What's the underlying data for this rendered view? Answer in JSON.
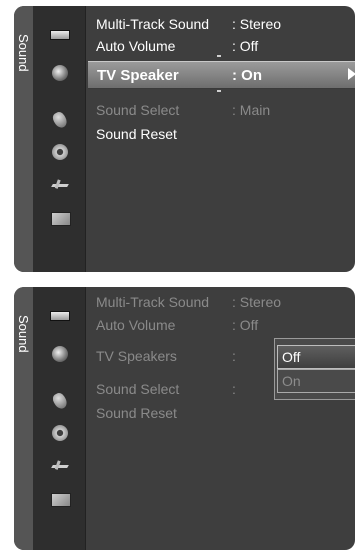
{
  "panel1": {
    "side_label": "Sound",
    "menu": [
      {
        "label": "Multi-Track Sound",
        "value": ": Stereo"
      },
      {
        "label": "Auto Volume",
        "value": ": Off"
      },
      {
        "label": "TV Speaker",
        "value": ": On"
      },
      {
        "label": "Sound Select",
        "value": ": Main"
      },
      {
        "label": "Sound Reset",
        "value": ""
      }
    ]
  },
  "panel2": {
    "side_label": "Sound",
    "menu": [
      {
        "label": "Multi-Track Sound",
        "value": ": Stereo"
      },
      {
        "label": "Auto Volume",
        "value": ": Off"
      },
      {
        "label": "TV Speakers",
        "value": ":"
      },
      {
        "label": "Sound Select",
        "value": ":"
      },
      {
        "label": "Sound Reset",
        "value": ""
      }
    ],
    "dropdown": {
      "options": [
        "Off",
        "On"
      ],
      "selected": "Off"
    }
  },
  "icons": [
    "picture-icon",
    "sound-icon",
    "channel-icon",
    "setup-icon",
    "input-icon",
    "application-icon"
  ]
}
